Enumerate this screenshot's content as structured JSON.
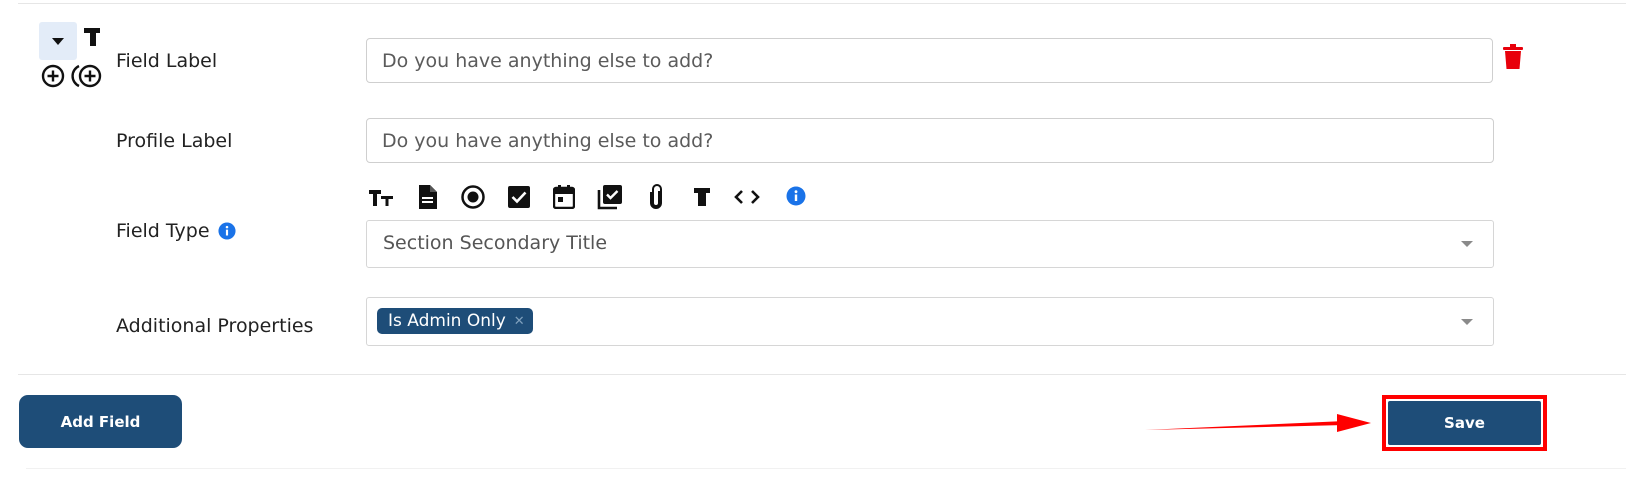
{
  "field_row": {
    "field_label": {
      "label": "Field Label",
      "placeholder": "Do you have anything else to add?"
    },
    "profile_label": {
      "label": "Profile Label",
      "placeholder": "Do you have anything else to add?"
    },
    "field_type": {
      "label": "Field Type",
      "selected": "Section Secondary Title",
      "type_icons": [
        "text-size-icon",
        "document-icon",
        "radio-button-icon",
        "checkbox-icon",
        "calendar-icon",
        "checklist-icon",
        "paperclip-icon",
        "title-text-icon",
        "code-icon",
        "info-icon"
      ]
    },
    "additional_properties": {
      "label": "Additional Properties",
      "chips": [
        "Is Admin Only"
      ]
    }
  },
  "actions": {
    "add_field_label": "Add Field",
    "save_label": "Save"
  },
  "colors": {
    "primary": "#1e4d78",
    "danger": "#e8000b",
    "info": "#1a73e8",
    "highlight": "#ff0000"
  }
}
